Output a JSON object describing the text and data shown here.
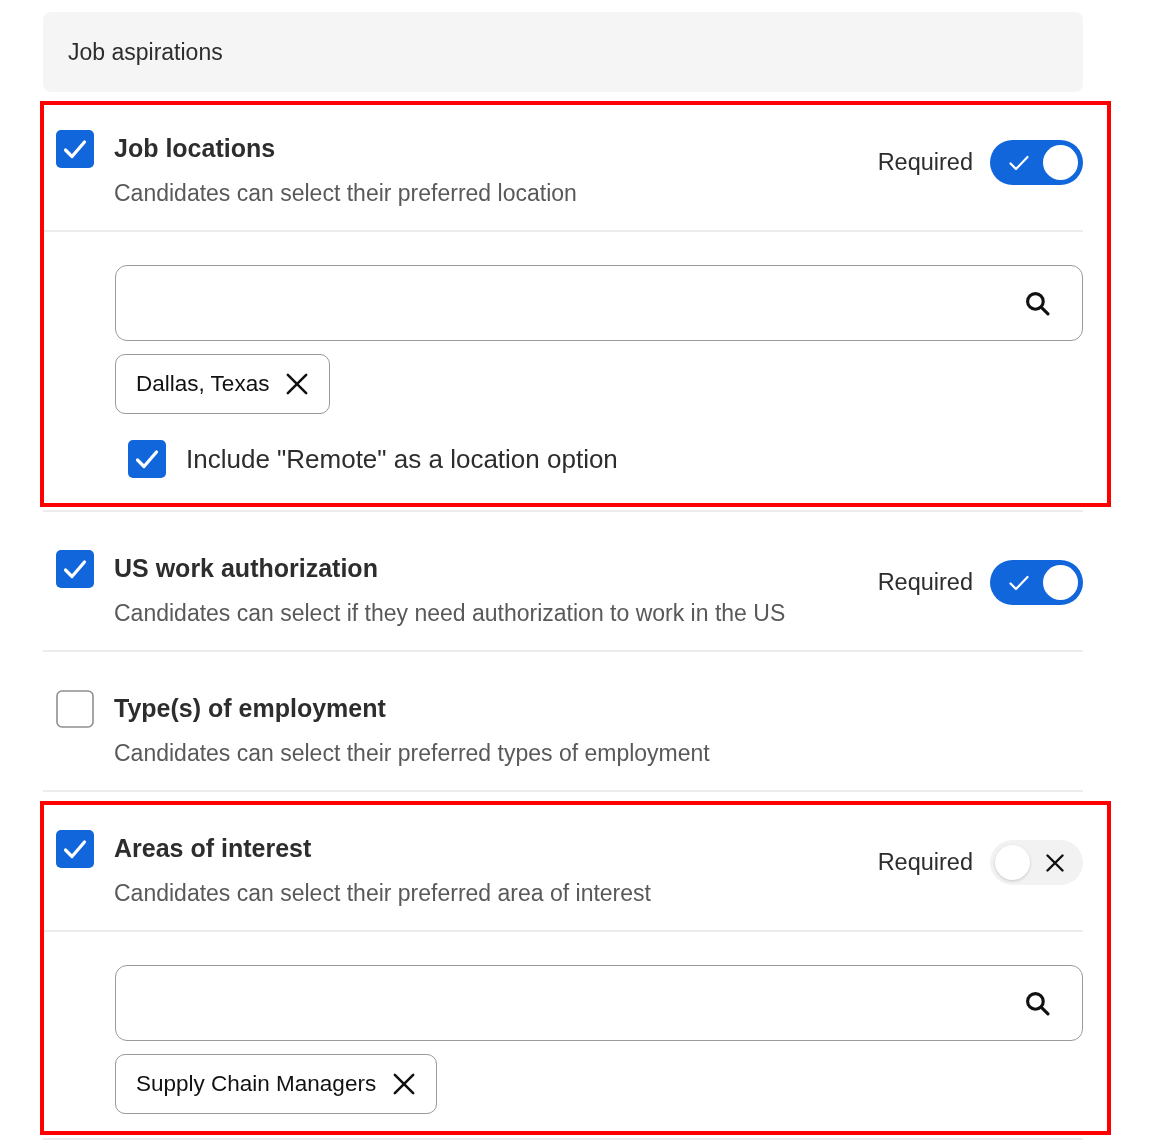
{
  "header": {
    "title": "Job aspirations"
  },
  "sections": [
    {
      "title": "Job locations",
      "description": "Candidates can select their preferred location",
      "checked": true,
      "highlighted": true,
      "expanded": true,
      "required": {
        "label": "Required",
        "on": true
      },
      "chips": [
        {
          "label": "Dallas, Texas"
        }
      ],
      "options": [
        {
          "label": "Include \"Remote\" as a location option",
          "checked": true
        }
      ]
    },
    {
      "title": "US work authorization",
      "description": "Candidates can select if they need authorization to work in the US",
      "checked": true,
      "highlighted": false,
      "expanded": false,
      "required": {
        "label": "Required",
        "on": true
      }
    },
    {
      "title": "Type(s) of employment",
      "description": "Candidates can select their preferred types of employment",
      "checked": false,
      "highlighted": false,
      "expanded": false
    },
    {
      "title": "Areas of interest",
      "description": "Candidates can select their preferred area of interest",
      "checked": true,
      "highlighted": true,
      "expanded": true,
      "required": {
        "label": "Required",
        "on": false
      },
      "chips": [
        {
          "label": "Supply Chain Managers"
        }
      ]
    }
  ]
}
